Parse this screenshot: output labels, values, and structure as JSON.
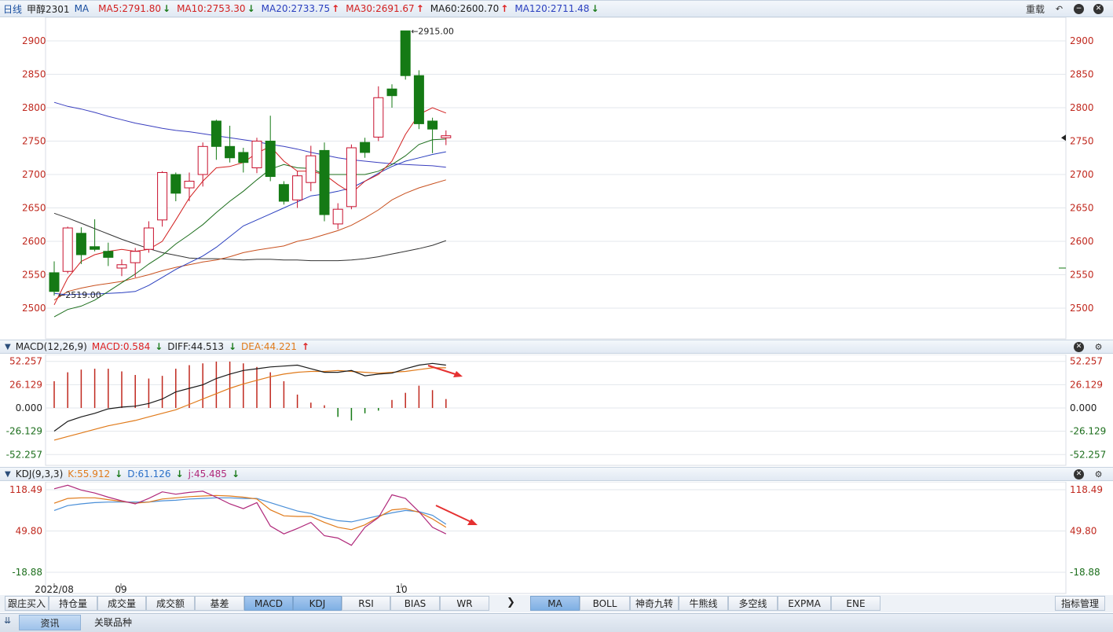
{
  "header": {
    "period": "日线",
    "symbol": "甲醇2301",
    "indicator": "MA",
    "ma": [
      {
        "label": "MA5:2791.80",
        "dir": "down",
        "color": "#d22020"
      },
      {
        "label": "MA10:2753.30",
        "dir": "down",
        "color": "#d22020"
      },
      {
        "label": "MA20:2733.75",
        "dir": "up",
        "color": "#2a3fbf"
      },
      {
        "label": "MA30:2691.67",
        "dir": "up",
        "color": "#d22020"
      },
      {
        "label": "MA60:2600.70",
        "dir": "up",
        "color": "#222222"
      },
      {
        "label": "MA120:2711.48",
        "dir": "down",
        "color": "#2a3fbf"
      }
    ],
    "reload_label": "重载"
  },
  "macd_header": {
    "name": "MACD(12,26,9)",
    "macd": "MACD:0.584",
    "diff": "DIFF:44.513",
    "dea": "DEA:44.221"
  },
  "kdj_header": {
    "name": "KDJ(9,3,3)",
    "k": "K:55.912",
    "d": "D:61.126",
    "j": "j:45.485"
  },
  "price_ticks": [
    "2900",
    "2850",
    "2800",
    "2750",
    "2700",
    "2650",
    "2600",
    "2550",
    "2500"
  ],
  "macd_ticks": [
    "52.257",
    "26.129",
    "0.000",
    "-26.129",
    "-52.257"
  ],
  "kdj_ticks": [
    "118.49",
    "49.80",
    "-18.88"
  ],
  "date_labels": [
    "2022/08",
    "09",
    "10"
  ],
  "annotations": {
    "high": "2915.00",
    "low": "2519.00"
  },
  "tabs_left": [
    "跟庄买入",
    "持仓量",
    "成交量",
    "成交额",
    "基差",
    "MACD",
    "KDJ",
    "RSI",
    "BIAS",
    "WR"
  ],
  "tabs_right": [
    "MA",
    "BOLL",
    "神奇九转",
    "牛熊线",
    "多空线",
    "EXPMA",
    "ENE"
  ],
  "active_tabs": [
    "MACD",
    "KDJ",
    "MA"
  ],
  "indicator_manage": "指标管理",
  "bottom_tabs": [
    "资讯",
    "关联品种"
  ],
  "colors": {
    "up": "#c8102e",
    "down": "#157a15",
    "ma5": "#d22020",
    "ma10": "#1c6e1c",
    "ma20": "#2a3fbf",
    "ma30": "#c8501e",
    "ma60": "#333333",
    "ma120": "#3a3fbf",
    "diff": "#1a1a1a",
    "dea": "#e07a1a",
    "k": "#e07a1a",
    "d": "#4a8fd8",
    "j": "#b0287a"
  },
  "chart_data": {
    "type": "candlestick",
    "candles": [
      [
        2553,
        2525,
        2570,
        2519
      ],
      [
        2555,
        2620,
        2622,
        2552
      ],
      [
        2612,
        2580,
        2621,
        2566
      ],
      [
        2592,
        2588,
        2633,
        2585
      ],
      [
        2585,
        2576,
        2598,
        2563
      ],
      [
        2560,
        2565,
        2573,
        2548
      ],
      [
        2568,
        2585,
        2590,
        2546
      ],
      [
        2588,
        2620,
        2630,
        2583
      ],
      [
        2632,
        2703,
        2705,
        2622
      ],
      [
        2700,
        2672,
        2703,
        2660
      ],
      [
        2680,
        2690,
        2703,
        2660
      ],
      [
        2700,
        2742,
        2748,
        2682
      ],
      [
        2780,
        2742,
        2782,
        2722
      ],
      [
        2742,
        2725,
        2773,
        2718
      ],
      [
        2733,
        2718,
        2740,
        2703
      ],
      [
        2710,
        2750,
        2755,
        2702
      ],
      [
        2750,
        2697,
        2788,
        2690
      ],
      [
        2685,
        2660,
        2690,
        2655
      ],
      [
        2662,
        2698,
        2705,
        2650
      ],
      [
        2688,
        2728,
        2743,
        2675
      ],
      [
        2736,
        2640,
        2748,
        2630
      ],
      [
        2626,
        2648,
        2657,
        2618
      ],
      [
        2652,
        2740,
        2745,
        2648
      ],
      [
        2748,
        2733,
        2755,
        2725
      ],
      [
        2756,
        2815,
        2832,
        2750
      ],
      [
        2828,
        2818,
        2835,
        2800
      ],
      [
        2915,
        2848,
        2915,
        2842
      ],
      [
        2848,
        2776,
        2856,
        2768
      ],
      [
        2780,
        2768,
        2785,
        2732
      ],
      [
        2755,
        2758,
        2766,
        2744
      ]
    ],
    "ma5": [
      2505,
      2545,
      2570,
      2580,
      2585,
      2588,
      2585,
      2588,
      2600,
      2632,
      2665,
      2690,
      2710,
      2712,
      2718,
      2732,
      2742,
      2720,
      2705,
      2705,
      2700,
      2685,
      2672,
      2690,
      2700,
      2720,
      2760,
      2790,
      2800,
      2792
    ],
    "ma10": [
      2487,
      2498,
      2503,
      2512,
      2525,
      2538,
      2551,
      2566,
      2579,
      2596,
      2610,
      2625,
      2643,
      2660,
      2675,
      2692,
      2708,
      2715,
      2710,
      2709,
      2700,
      2700,
      2700,
      2700,
      2705,
      2715,
      2728,
      2745,
      2752,
      2753
    ],
    "ma20": [
      2522,
      2520,
      2521,
      2521,
      2522,
      2523,
      2525,
      2534,
      2546,
      2558,
      2568,
      2578,
      2591,
      2607,
      2623,
      2632,
      2641,
      2650,
      2659,
      2668,
      2671,
      2675,
      2680,
      2690,
      2702,
      2712,
      2720,
      2725,
      2730,
      2734
    ],
    "ma30": [
      2512,
      2525,
      2530,
      2534,
      2537,
      2540,
      2545,
      2550,
      2556,
      2561,
      2565,
      2569,
      2572,
      2577,
      2583,
      2587,
      2590,
      2593,
      2600,
      2604,
      2610,
      2616,
      2624,
      2635,
      2647,
      2662,
      2672,
      2680,
      2686,
      2692
    ],
    "ma60": [
      2642,
      2635,
      2627,
      2619,
      2611,
      2603,
      2596,
      2589,
      2583,
      2579,
      2575,
      2574,
      2574,
      2573,
      2572,
      2573,
      2573,
      2572,
      2572,
      2571,
      2571,
      2571,
      2572,
      2574,
      2577,
      2581,
      2585,
      2589,
      2594,
      2601
    ],
    "ma120": [
      2808,
      2802,
      2798,
      2793,
      2787,
      2782,
      2777,
      2773,
      2769,
      2766,
      2764,
      2761,
      2758,
      2755,
      2752,
      2749,
      2745,
      2742,
      2738,
      2733,
      2729,
      2725,
      2722,
      2720,
      2718,
      2716,
      2715,
      2714,
      2713,
      2711
    ],
    "macd_hist": [
      30,
      40,
      43,
      44,
      44,
      41,
      37,
      33,
      36,
      44,
      48,
      50,
      52,
      52,
      50,
      46,
      40,
      30,
      15,
      6,
      3,
      -10,
      -14,
      -6,
      -3,
      9,
      17,
      25,
      20,
      10
    ],
    "diff": [
      -26,
      -15,
      -10,
      -6,
      -1,
      1,
      2,
      5,
      10,
      18,
      22,
      26,
      33,
      38,
      42,
      44,
      46,
      47,
      48,
      44,
      40,
      40,
      42,
      36,
      38,
      39,
      44,
      48,
      50,
      48,
      44.5
    ],
    "dea": [
      -36,
      -32,
      -28,
      -24,
      -20,
      -17,
      -14,
      -10,
      -6,
      -2,
      4,
      10,
      16,
      22,
      27,
      31,
      35,
      38,
      40,
      41,
      41,
      42,
      41,
      40,
      39,
      40,
      41,
      43,
      45,
      45,
      44.2
    ],
    "k": [
      96,
      104,
      105,
      105,
      102,
      99,
      96,
      98,
      103,
      105,
      107,
      108,
      109,
      108,
      106,
      103,
      85,
      75,
      74,
      74,
      64,
      56,
      52,
      60,
      73,
      85,
      87,
      81,
      70,
      56
    ],
    "d": [
      84,
      92,
      95,
      97,
      98,
      98,
      98,
      98,
      100,
      101,
      103,
      104,
      105,
      105,
      104,
      104,
      97,
      90,
      83,
      79,
      72,
      67,
      65,
      70,
      75,
      80,
      84,
      82,
      76,
      61
    ],
    "j": [
      120,
      126,
      118,
      113,
      106,
      100,
      95,
      104,
      115,
      111,
      114,
      116,
      106,
      95,
      87,
      97,
      58,
      45,
      54,
      64,
      42,
      38,
      26,
      56,
      72,
      110,
      104,
      82,
      56,
      45
    ]
  }
}
